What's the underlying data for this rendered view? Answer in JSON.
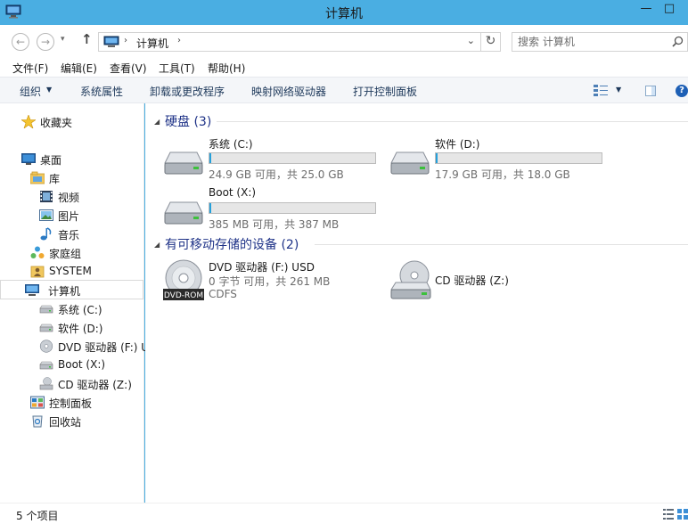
{
  "window": {
    "title": "计算机",
    "minimize": "—",
    "maximize": "□"
  },
  "address_bar": {
    "back": "←",
    "forward": "→",
    "recent": "▾",
    "up": "↑",
    "breadcrumb": "计算机",
    "separator": "›",
    "dropdown": "⌄",
    "refresh": "↻",
    "search_placeholder": "搜索 计算机"
  },
  "menu": [
    {
      "label": "文件(F)"
    },
    {
      "label": "编辑(E)"
    },
    {
      "label": "查看(V)"
    },
    {
      "label": "工具(T)"
    },
    {
      "label": "帮助(H)"
    }
  ],
  "commands": {
    "organize": "组织",
    "arrow": "▼",
    "system_properties": "系统属性",
    "uninstall_programs": "卸载或更改程序",
    "map_network_drive": "映射网络驱动器",
    "open_control_panel": "打开控制面板",
    "help": "?"
  },
  "nav": {
    "favorites": "收藏夹",
    "desktop": "桌面",
    "libraries": "库",
    "videos": "视频",
    "pictures": "图片",
    "music": "音乐",
    "homegroup": "家庭组",
    "system": "SYSTEM",
    "computer": "计算机",
    "drive_c": "系统 (C:)",
    "drive_d": "软件 (D:)",
    "drive_f": "DVD 驱动器 (F:) U",
    "drive_x": "Boot (X:)",
    "drive_z": "CD 驱动器 (Z:)",
    "control_panel": "控制面板",
    "recycle_bin": "回收站"
  },
  "groups": {
    "toggle": "◢",
    "hard_disks": "硬盘 (3)",
    "removable": "有可移动存储的设备 (2)"
  },
  "drives": {
    "c": {
      "name": "系统 (C:)",
      "space": "24.9 GB 可用，共 25.0 GB",
      "used_fraction": 0.004
    },
    "d": {
      "name": "软件 (D:)",
      "space": "17.9 GB 可用，共 18.0 GB",
      "used_fraction": 0.006
    },
    "x": {
      "name": "Boot (X:)",
      "space": "385 MB 可用，共 387 MB",
      "used_fraction": 0.005
    },
    "f": {
      "name": "DVD 驱动器 (F:) USD",
      "space": "0 字节 可用，共 261 MB",
      "fs": "CDFS",
      "dvd_label": "DVD-ROM"
    },
    "z": {
      "name": "CD 驱动器 (Z:)"
    }
  },
  "status": {
    "items": "5 个项目"
  },
  "colors": {
    "titlebar": "#4aaee2",
    "group_title": "#1e3287",
    "bar_fill": "#26a0da",
    "command_text": "#1e395b"
  }
}
